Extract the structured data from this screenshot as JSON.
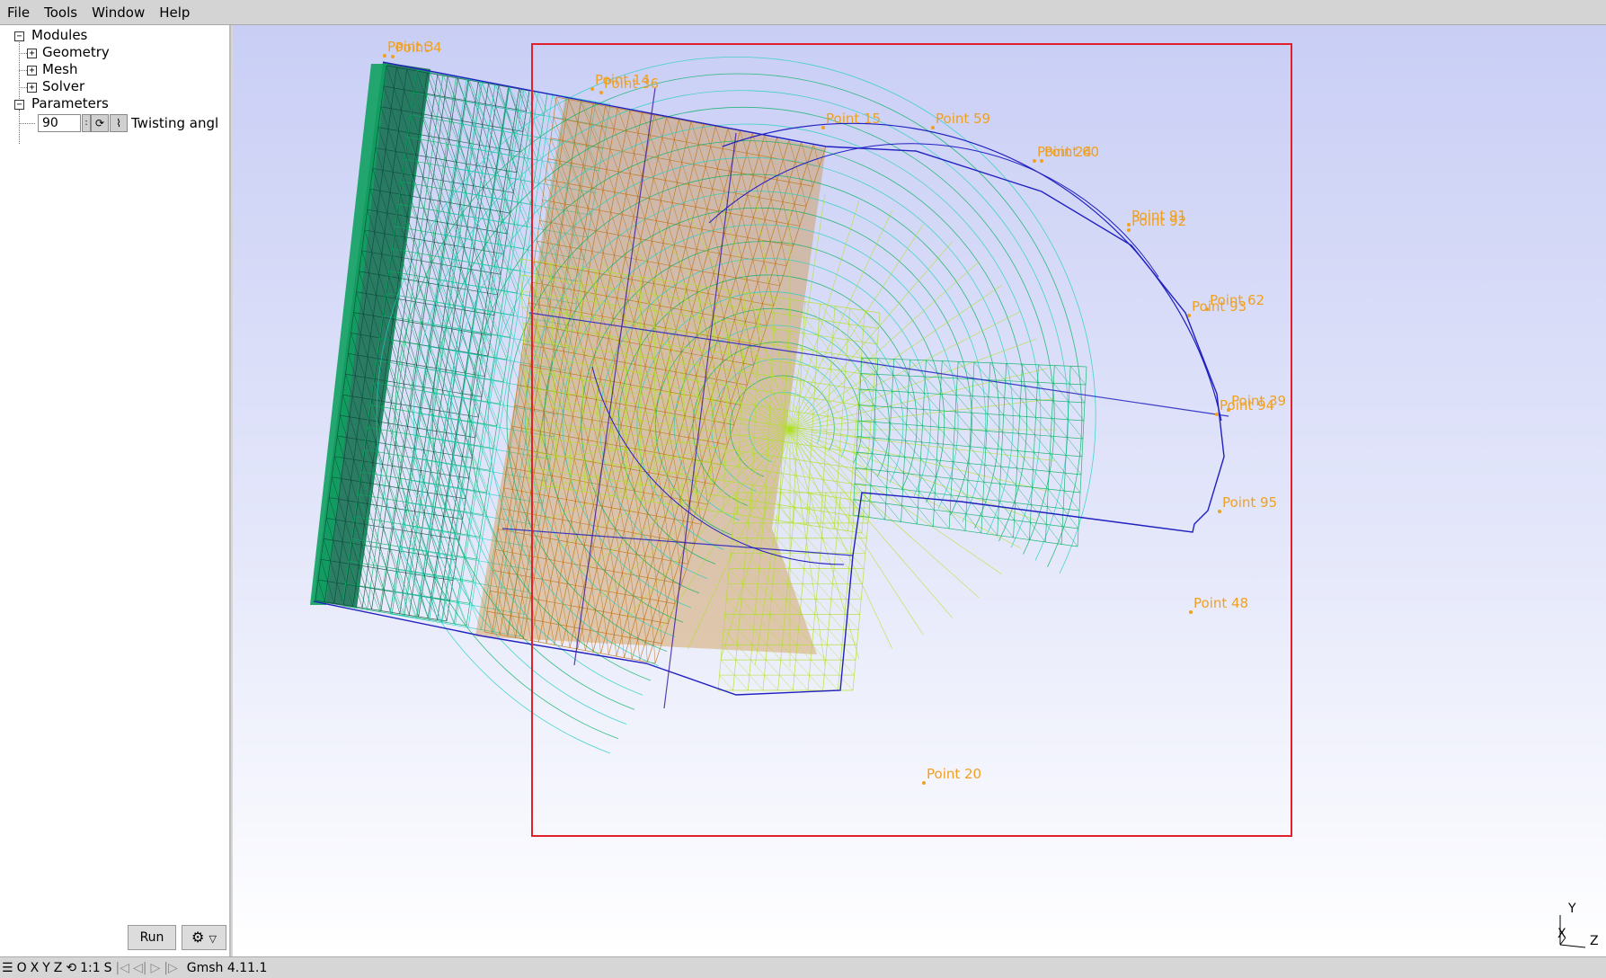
{
  "menu": {
    "file": "File",
    "tools": "Tools",
    "window": "Window",
    "help": "Help"
  },
  "tree": {
    "modules": "Modules",
    "geometry": "Geometry",
    "mesh": "Mesh",
    "solver": "Solver",
    "parameters": "Parameters",
    "twisting_angle_label": "Twisting angle",
    "twisting_angle_value": "90"
  },
  "buttons": {
    "run": "Run"
  },
  "points": [
    {
      "label": "Point 3"
    },
    {
      "label": "Point 4"
    },
    {
      "label": "Point 14"
    },
    {
      "label": "Point 36"
    },
    {
      "label": "Point 15"
    },
    {
      "label": "Point 59"
    },
    {
      "label": "Point 24"
    },
    {
      "label": "Point 60"
    },
    {
      "label": "Point 91"
    },
    {
      "label": "Point 92"
    },
    {
      "label": "Point 62"
    },
    {
      "label": "Point 93"
    },
    {
      "label": "Point 39"
    },
    {
      "label": "Point 94"
    },
    {
      "label": "Point 95"
    },
    {
      "label": "Point 48"
    },
    {
      "label": "Point 20"
    }
  ],
  "axes": {
    "y": "Y",
    "x": "X",
    "z": "Z"
  },
  "status": {
    "o": "O",
    "x": "X",
    "y": "Y",
    "z": "Z",
    "scale": "1:1",
    "s": "S",
    "version": "Gmsh 4.11.1"
  },
  "icons": {
    "menu": "hamburger-icon",
    "rotate": "rotate-icon",
    "settings": "gear-icon",
    "param_loop": "loop-icon",
    "param_graph": "graph-icon"
  },
  "colors": {
    "point_label": "#f0a020",
    "selection_box": "#e0202a",
    "mesh_blue": "#2020c0",
    "mesh_green": "#00b060",
    "mesh_orange": "#c07010",
    "mesh_cyan": "#20d0c0",
    "mesh_yellow": "#b0e020"
  }
}
